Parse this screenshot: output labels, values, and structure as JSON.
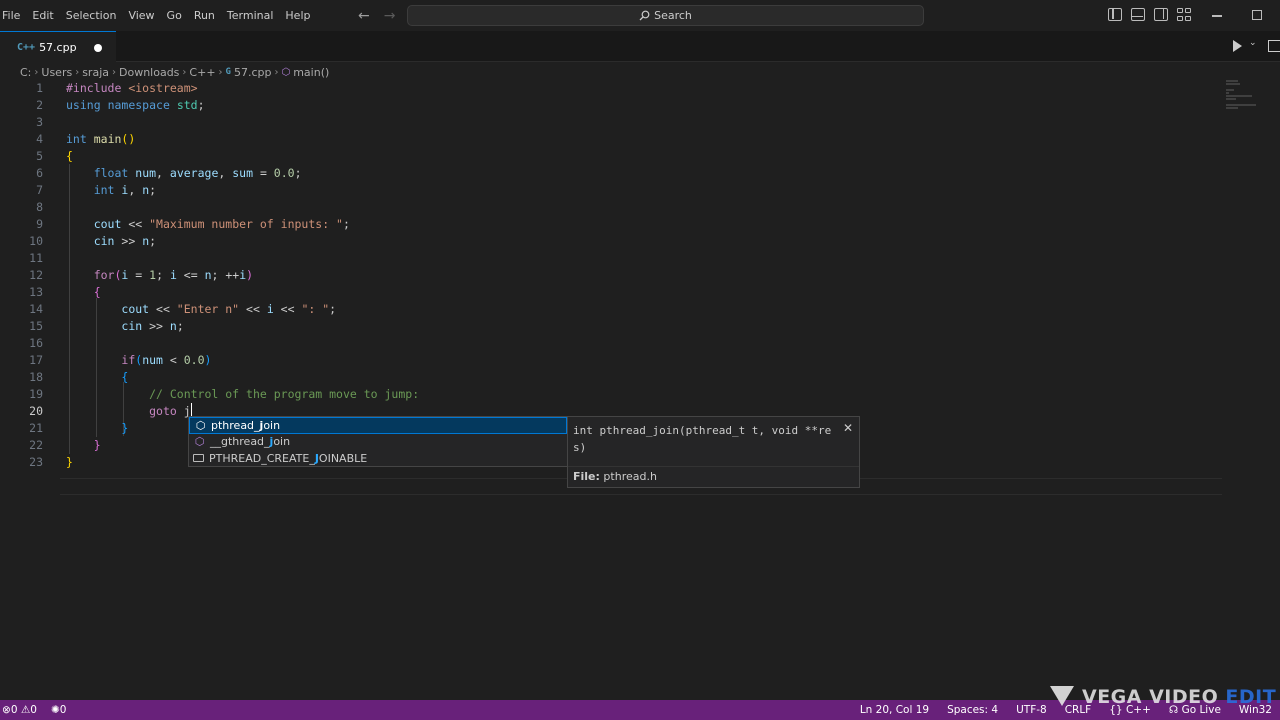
{
  "menu": [
    "File",
    "Edit",
    "Selection",
    "View",
    "Go",
    "Run",
    "Terminal",
    "Help"
  ],
  "search": {
    "label": "Search"
  },
  "tab": {
    "icon": "C++",
    "label": "57.cpp"
  },
  "breadcrumb": [
    "C:",
    "Users",
    "sraja",
    "Downloads",
    "C++",
    "57.cpp",
    "main()"
  ],
  "editor": {
    "line_numbers": [
      "1",
      "2",
      "3",
      "4",
      "5",
      "6",
      "7",
      "8",
      "9",
      "10",
      "11",
      "12",
      "13",
      "14",
      "15",
      "16",
      "17",
      "18",
      "19",
      "20",
      "21",
      "22",
      "23"
    ],
    "current_line": 20
  },
  "suggestions": [
    {
      "pre": "pthread_",
      "match": "j",
      "post": "oin",
      "kind": "cube-icon"
    },
    {
      "pre": "__gthread_",
      "match": "j",
      "post": "oin",
      "kind": "cube-icon"
    },
    {
      "pre": "PTHREAD_CREATE_",
      "match": "J",
      "post": "OINABLE",
      "kind": "constant-icon"
    }
  ],
  "details": {
    "signature": "int pthread_join(pthread_t t, void **res)",
    "file_label": "File:",
    "file_value": "pthread.h"
  },
  "statusbar": {
    "errors": "0",
    "warnings": "0",
    "ports": "0",
    "position": "Ln 20, Col 19",
    "spaces": "Spaces: 4",
    "encoding": "UTF-8",
    "eol": "CRLF",
    "language": "C++",
    "golive": "Go Live",
    "platform": "Win32"
  },
  "watermark": {
    "main": "VEGA VIDEO ",
    "accent": "EDIT"
  }
}
